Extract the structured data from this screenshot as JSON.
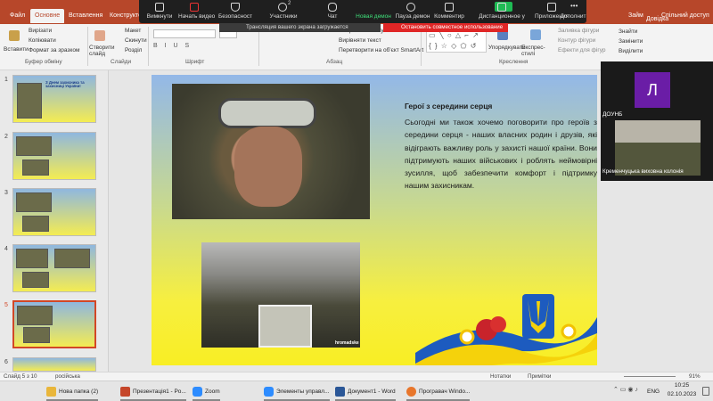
{
  "ribbon_tabs": [
    "Файл",
    "Основне",
    "Вставлення",
    "Конструктор"
  ],
  "ribbon_tabs_right": [
    "Займ",
    "Довідка"
  ],
  "share_label": "Спільний доступ",
  "ribbon": {
    "paste": "Вставити",
    "cut": "Вирізати",
    "copy": "Копіювати",
    "format_painter": "Формат за зразком",
    "clipboard_group": "Буфер обміну",
    "new_slide": "Створити слайд",
    "layout": "Макет",
    "reset": "Скинути",
    "section": "Розділ",
    "slides_group": "Слайди",
    "font_group": "Шрифт",
    "paragraph_group": "Абзац",
    "text_direction": "Напрямок тексту",
    "align_text": "Вирівняти текст",
    "smartart": "Перетворити на об'єкт SmartArt",
    "arrange": "Упорядкувати",
    "quick_styles": "Експрес-стилі",
    "shape_fill": "Заливка фігури",
    "shape_outline": "Контур фігури",
    "shape_effects": "Ефекти для фігур",
    "drawing_group": "Креслення",
    "find": "Знайти",
    "replace": "Замінити",
    "select": "Виділити"
  },
  "zoom_toolbar": [
    {
      "label": "Вимкнути",
      "icon": "microphone-icon"
    },
    {
      "label": "Начать видео",
      "icon": "video-camera-icon"
    },
    {
      "label": "Безопасност",
      "icon": "shield-icon"
    },
    {
      "label": "Участники",
      "icon": "participants-icon"
    },
    {
      "label": "Чат",
      "icon": "chat-icon"
    },
    {
      "label": "Новая демон",
      "icon": "share-screen-icon"
    },
    {
      "label": "Пауза демон",
      "icon": "pause-icon"
    },
    {
      "label": "Комментир",
      "icon": "annotate-icon"
    },
    {
      "label": "Дистанционное у",
      "icon": "remote-control-icon"
    },
    {
      "label": "Приложения",
      "icon": "apps-icon"
    },
    {
      "label": "Дополнит",
      "icon": "more-icon"
    }
  ],
  "participants_count": "2",
  "zoom_banner": "Трансляция вашего экрана загружается",
  "zoom_stop": "Остановить совместное использование",
  "slides": [
    {
      "num": "1",
      "title": "З Днем захисника та захисниці України!"
    },
    {
      "num": "2",
      "title": ""
    },
    {
      "num": "3",
      "title": ""
    },
    {
      "num": "4",
      "title": ""
    },
    {
      "num": "5",
      "title": ""
    },
    {
      "num": "6",
      "title": ""
    }
  ],
  "slide": {
    "heading": "Герої з середини серця",
    "body": "Сьогодні ми також хочемо поговорити про героїв з середини серця - наших власних родин і друзів, які відіграють важливу роль у захисті нашої країни. Вони підтримують наших військових і роблять неймовірні зусилля, щоб забезпечити комфорт і підтримку нашим захисникам.",
    "photo_caption": "hromadske"
  },
  "video_panel": {
    "avatar_letter": "Л",
    "name1": "ДОУНБ",
    "name2": "Кременчуцька виховна колонія"
  },
  "status": {
    "slide_info": "Слайд 5 з 10",
    "language": "російська",
    "notes": "Нотатки",
    "comments": "Примітки",
    "zoom": "91%"
  },
  "taskbar": [
    {
      "label": "Нова папка (2)",
      "color": "#e9b63b"
    },
    {
      "label": "Презентація1 - Po...",
      "color": "#c5462a"
    },
    {
      "label": "Zoom",
      "color": "#2d8cff"
    },
    {
      "label": "Элементы управл...",
      "color": "#2d8cff"
    },
    {
      "label": "Документ1 - Word",
      "color": "#2b5797"
    },
    {
      "label": "Програвач Windo...",
      "color": "#e8762b"
    }
  ],
  "tray": {
    "lang": "ENG",
    "time": "10:25",
    "date": "02.10.2023"
  }
}
